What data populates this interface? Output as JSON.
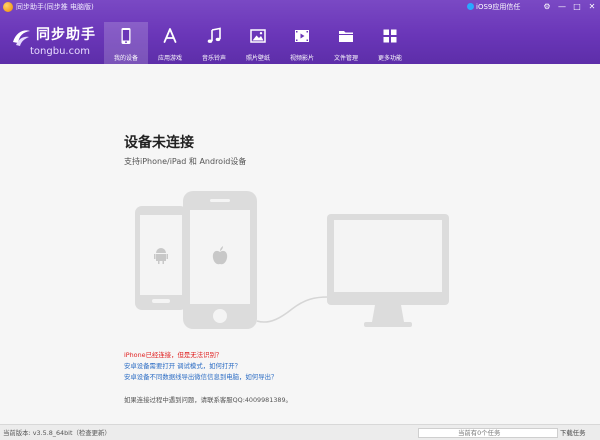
{
  "window": {
    "title": "同步助手(同步推 电脑版)",
    "ios_trust_label": "iOS9应用信任",
    "controls": [
      "⚙",
      "—",
      "□",
      "✕"
    ]
  },
  "logo": {
    "main_text": "同步助手",
    "sub_text": "tongbu.com"
  },
  "nav": {
    "items": [
      {
        "label": "我的设备",
        "icon": "phone-icon",
        "active": true
      },
      {
        "label": "应用游戏",
        "icon": "app-store-icon",
        "active": false
      },
      {
        "label": "音乐铃声",
        "icon": "music-note-icon",
        "active": false
      },
      {
        "label": "照片壁纸",
        "icon": "image-icon",
        "active": false
      },
      {
        "label": "视频影片",
        "icon": "video-icon",
        "active": false
      },
      {
        "label": "文件管理",
        "icon": "folder-icon",
        "active": false
      },
      {
        "label": "更多功能",
        "icon": "grid-icon",
        "active": false
      }
    ]
  },
  "main": {
    "heading": "设备未连接",
    "subtitle": "支持iPhone/iPad 和 Android设备",
    "help_links": [
      {
        "text": "iPhone已经连接，但是无法识别？",
        "color": "#e02020"
      },
      {
        "text": "安卓设备需要打开 调试模式，如何打开？",
        "color": "#2b6cc4"
      },
      {
        "text": "安卓设备不同数据线导出微信信息到电脑，如何导出？",
        "color": "#2b6cc4"
      }
    ],
    "contact": "如果连接过程中遇到问题，请联系客服QQ:4009981389。"
  },
  "statusbar": {
    "version": "当前版本: v3.5.8_64bit（检查更新）",
    "task_label": "当前有0个任务",
    "download_label": "下载任务"
  },
  "colors": {
    "header_purple": "#6a36b8",
    "link_red": "#e02020",
    "link_blue": "#2b6cc4",
    "device_gray": "#dcdcdc"
  }
}
